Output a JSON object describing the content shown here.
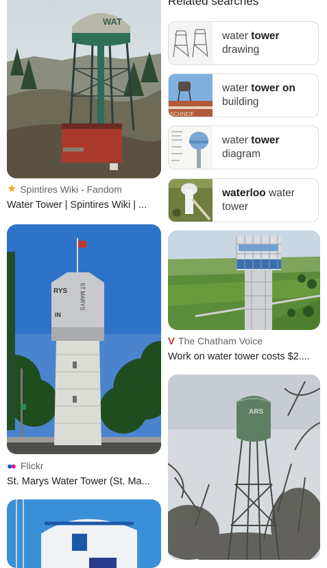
{
  "related": {
    "title": "Related searches",
    "items": [
      {
        "pre": "water ",
        "bold": "tower",
        "post": " drawing",
        "thumb": "drawing"
      },
      {
        "pre": "water ",
        "bold": "tower on",
        "post": " building",
        "thumb": "building"
      },
      {
        "pre": "water ",
        "bold": "tower",
        "post": " diagram",
        "thumb": "diagram"
      },
      {
        "pre": "",
        "bold": "waterloo",
        "post": " water tower",
        "thumb": "waterloo"
      }
    ]
  },
  "results": {
    "r1": {
      "source": "Spintires Wiki - Fandom",
      "title": "Water Tower | Spintires Wiki | ...",
      "icon": "fandom-star-icon",
      "tank_text": "WAT"
    },
    "r2": {
      "source": "Flickr",
      "title": "St. Marys Water Tower (St. Ma...",
      "icon": "flickr-dots-icon",
      "tank_text": "ST MARYS",
      "side_text": "RYS ... IN"
    },
    "r3": {
      "source": "The Chatham Voice",
      "title": "Work on water tower costs $2....",
      "icon": "chatham-v-icon"
    },
    "r4": {
      "tank_text": "ARS"
    },
    "r5": {
      "tank_text": ""
    }
  },
  "colors": {
    "source_grey": "#5f6368",
    "border": "#dadce0",
    "fandom_orange": "#f5a623",
    "chatham_red": "#c0392b",
    "flickr_blue": "#0063dc",
    "flickr_pink": "#ff0084"
  }
}
